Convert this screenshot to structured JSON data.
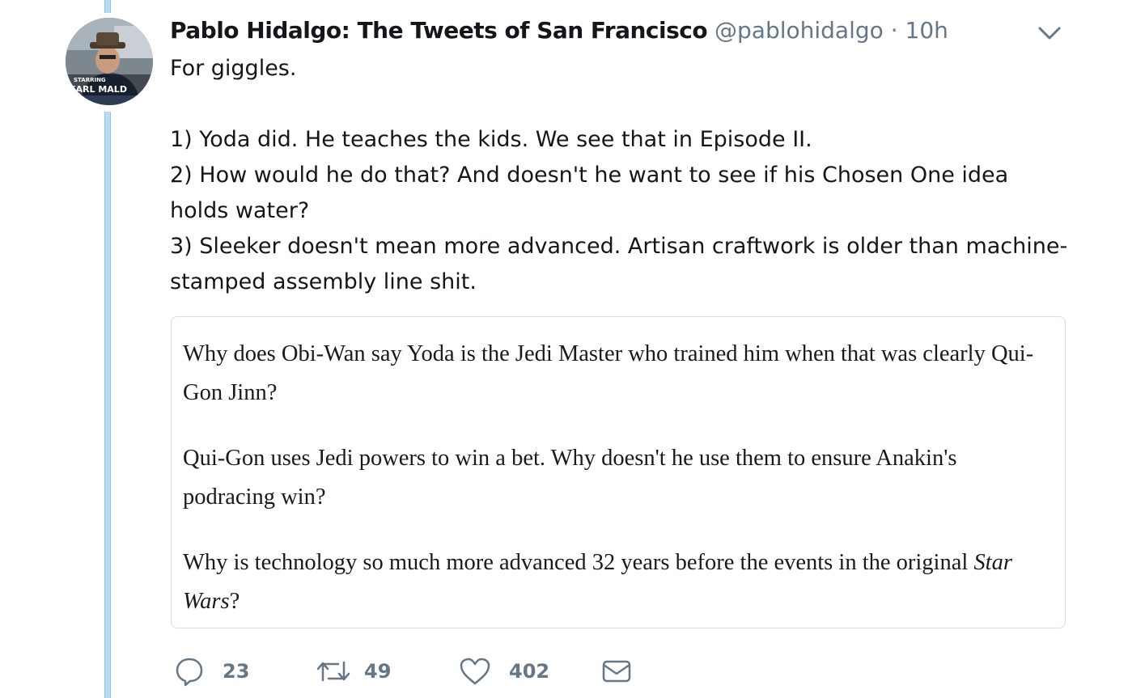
{
  "avatar": {
    "alt": "Pablo Hidalgo profile picture",
    "overlay_line1": "STARRING",
    "overlay_line2": "KARL MALD"
  },
  "tweet": {
    "display_name": "Pablo Hidalgo: The Tweets of San Francisco",
    "handle": "@pablohidalgo",
    "separator": "·",
    "time": "10h",
    "text_lines": [
      "For giggles.",
      "",
      "1) Yoda did. He teaches the kids. We see that in Episode II.",
      "2) How would he do that? And doesn't he want to see if his Chosen One idea holds water?",
      "3) Sleeker doesn't mean more advanced. Artisan craftwork is older than machine-stamped assembly line shit."
    ]
  },
  "quote": {
    "q1": "Why does Obi-Wan say Yoda is the Jedi Master who trained him when that was clearly Qui-Gon Jinn?",
    "q2": "Qui-Gon uses Jedi powers to win a bet. Why doesn't he use them to ensure Anakin's podracing win?",
    "q3_prefix": "Why is technology so much more advanced 32 years before the events in the original ",
    "q3_italic": "Star Wars",
    "q3_suffix": "?"
  },
  "actions": {
    "reply_count": "23",
    "retweet_count": "49",
    "like_count": "402"
  },
  "icons": {
    "menu": "chevron-down-icon",
    "reply": "reply-icon",
    "retweet": "retweet-icon",
    "like": "heart-icon",
    "dm": "envelope-icon"
  },
  "colors": {
    "thread_line": "#b8dcf2",
    "secondary_text": "#657786",
    "primary_text": "#14171a",
    "card_border": "#d7dde2"
  }
}
